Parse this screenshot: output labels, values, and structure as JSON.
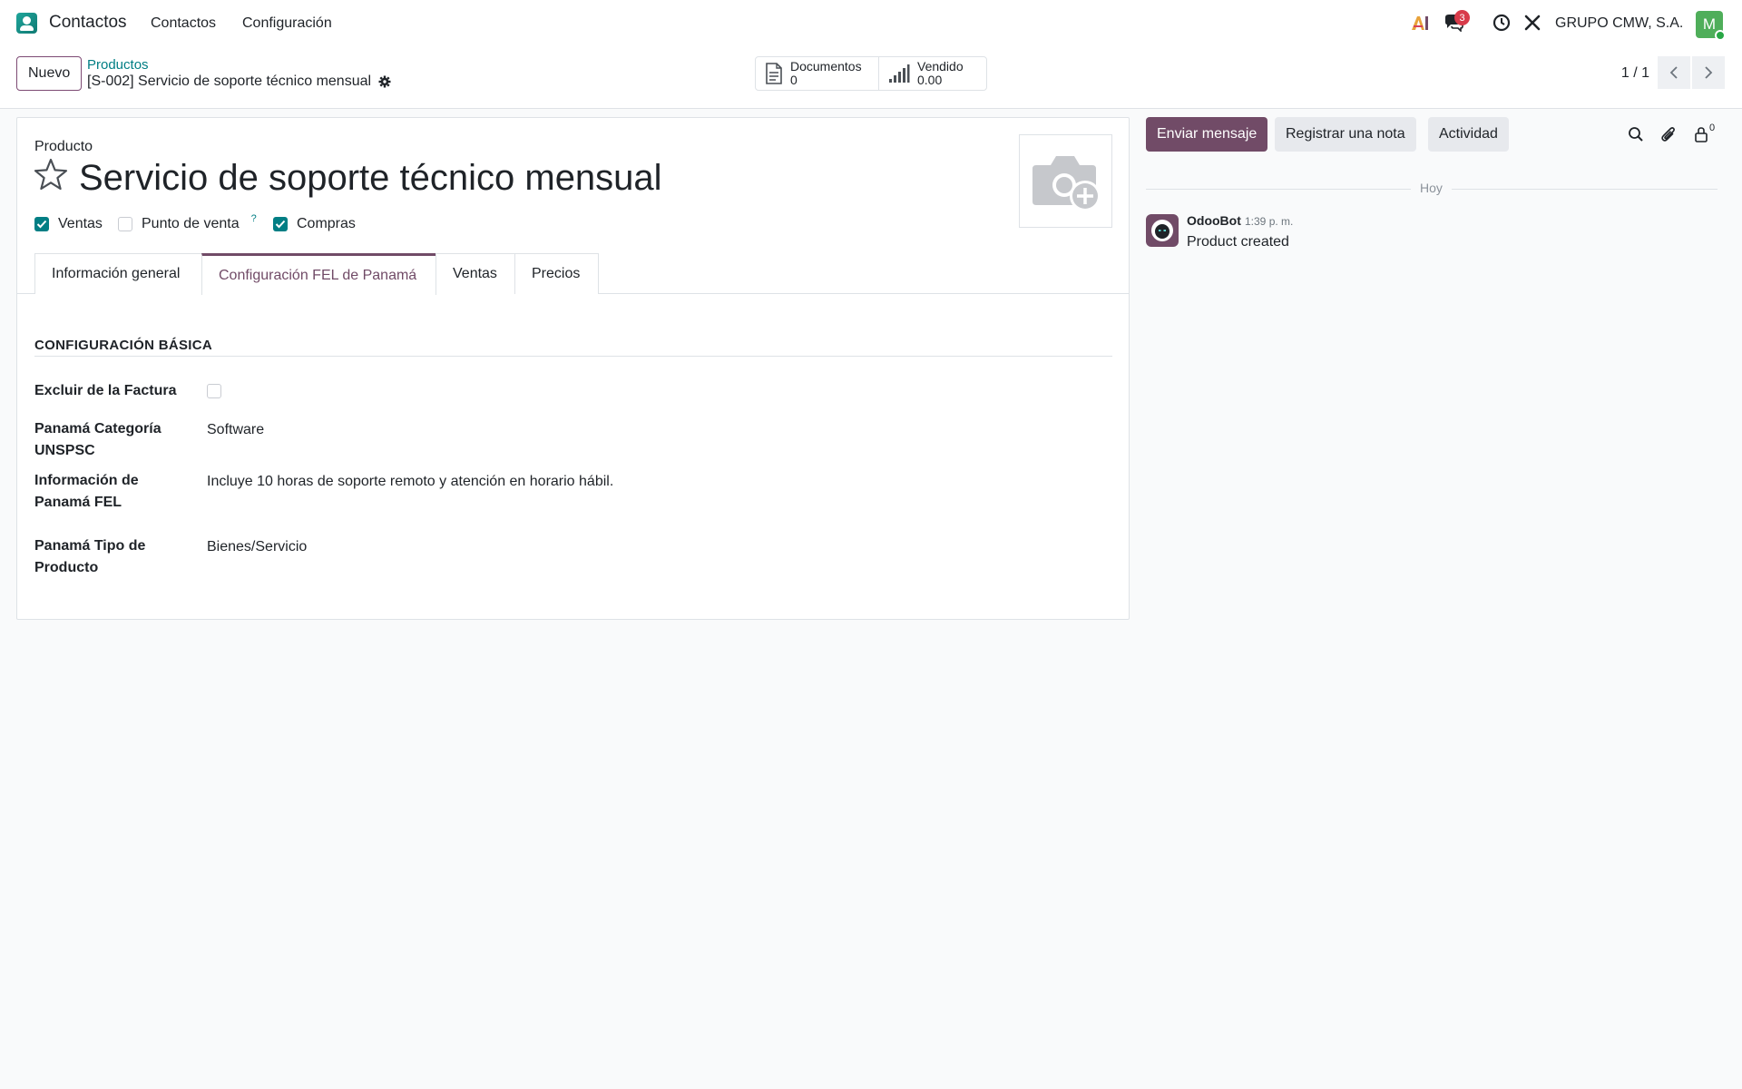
{
  "navbar": {
    "app_name": "Contactos",
    "menu": [
      "Contactos",
      "Configuración"
    ],
    "messages_count": "3",
    "company": "GRUPO CMW, S.A.",
    "avatar_initial": "M"
  },
  "control": {
    "new_label": "Nuevo",
    "breadcrumb_parent": "Productos",
    "breadcrumb_current": "[S-002] Servicio de soporte técnico mensual",
    "smart_buttons": [
      {
        "label": "Documentos",
        "value": "0"
      },
      {
        "label": "Vendido",
        "value": "0.00"
      }
    ],
    "pager": "1 / 1"
  },
  "form": {
    "type_label": "Producto",
    "name": "Servicio de soporte técnico mensual",
    "checkboxes": [
      {
        "label": "Ventas",
        "checked": true
      },
      {
        "label": "Punto de venta",
        "checked": false,
        "help": "?"
      },
      {
        "label": "Compras",
        "checked": true
      }
    ],
    "tabs": [
      "Información general",
      "Configuración FEL de Panamá",
      "Ventas",
      "Precios"
    ],
    "active_tab": "Configuración FEL de Panamá",
    "section_title": "CONFIGURACIÓN BÁSICA",
    "fields": {
      "excluir_label": "Excluir de la Factura",
      "categoria_label_1": "Panamá Categoría",
      "categoria_label_2": "UNSPSC",
      "categoria_value": "Software",
      "info_label_1": "Información de",
      "info_label_2": "Panamá FEL",
      "info_value": "Incluye 10 horas de soporte remoto y atención en horario hábil.",
      "tipo_label_1": "Panamá Tipo de",
      "tipo_label_2": "Producto",
      "tipo_value": "Bienes/Servicio"
    }
  },
  "chatter": {
    "send_message": "Enviar mensaje",
    "log_note": "Registrar una nota",
    "activity": "Actividad",
    "followers_count": "0",
    "date_separator": "Hoy",
    "message": {
      "author": "OdooBot",
      "time": "1:39 p. m.",
      "body": "Product created"
    }
  },
  "colors": {
    "primary": "#714b67",
    "teal": "#017e84",
    "badge": "#d83b4a"
  }
}
